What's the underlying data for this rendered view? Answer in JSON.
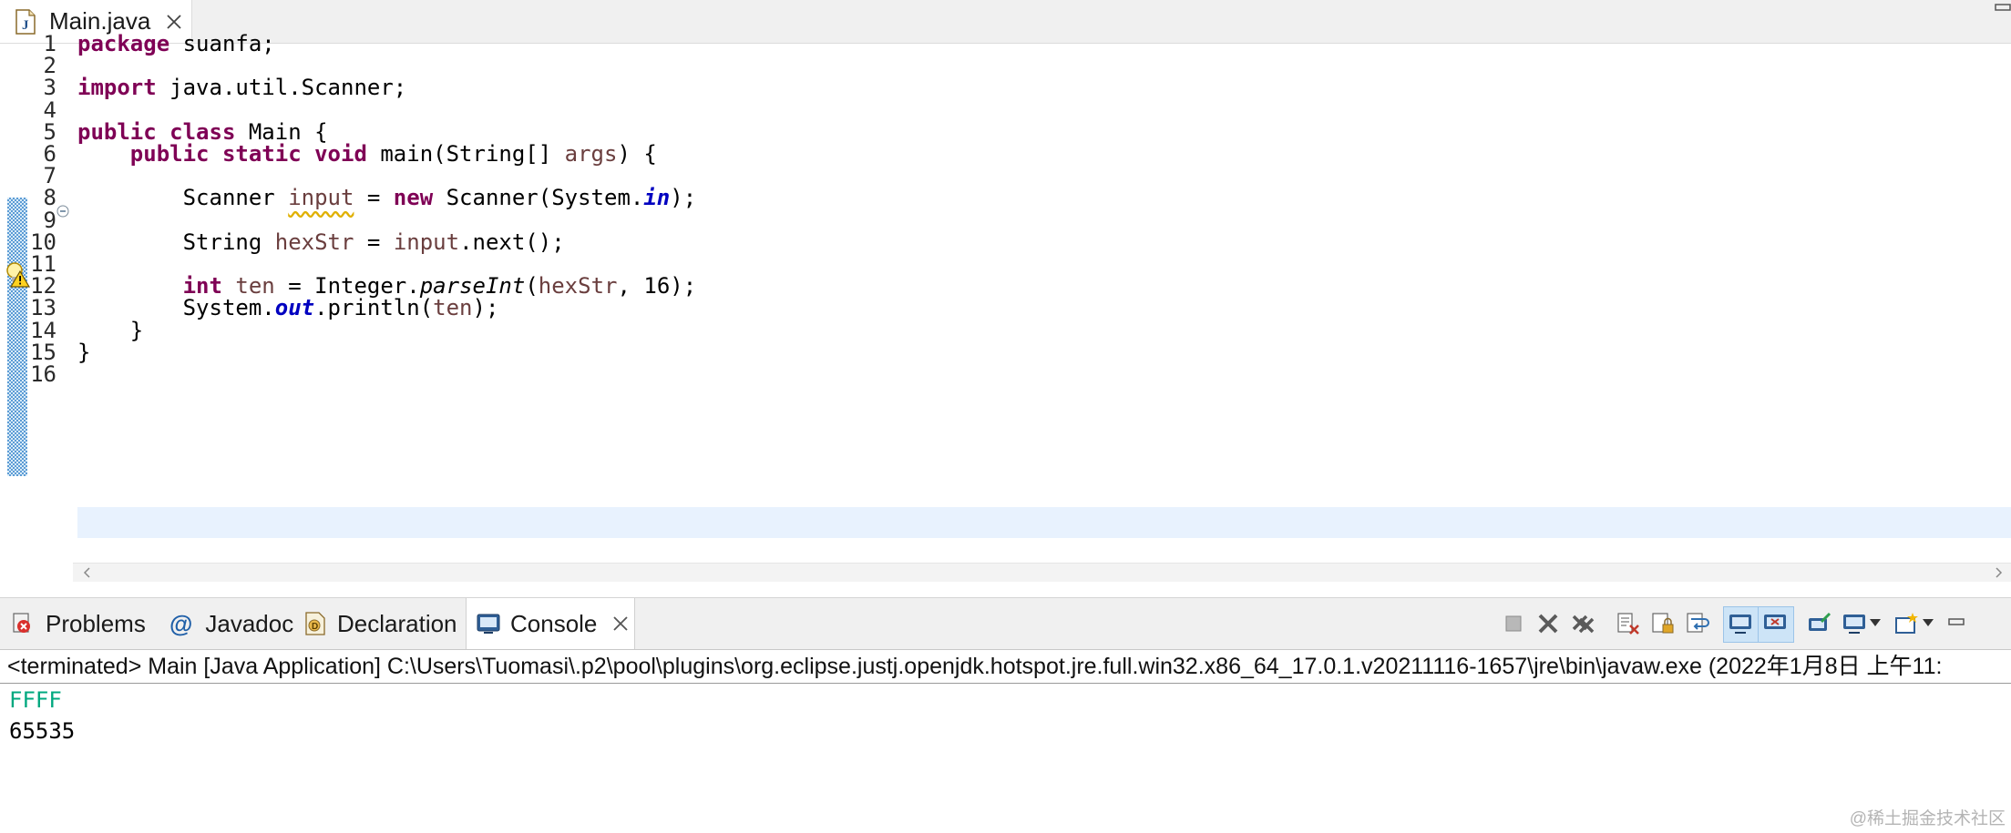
{
  "editor_tab": {
    "title": "Main.java"
  },
  "code": {
    "line_numbers": [
      "1",
      "2",
      "3",
      "4",
      "5",
      "6",
      "7",
      "8",
      "9",
      "10",
      "11",
      "12",
      "13",
      "14",
      "15",
      "16"
    ],
    "lines": [
      [
        {
          "t": "package",
          "k": "kw"
        },
        {
          "t": " suanfa;"
        }
      ],
      [],
      [
        {
          "t": "import",
          "k": "kw"
        },
        {
          "t": " java.util.Scanner;"
        }
      ],
      [],
      [
        {
          "t": "public",
          "k": "kw"
        },
        {
          "t": " "
        },
        {
          "t": "class",
          "k": "kw"
        },
        {
          "t": " Main {"
        }
      ],
      [
        {
          "t": "    "
        },
        {
          "t": "public",
          "k": "kw"
        },
        {
          "t": " "
        },
        {
          "t": "static",
          "k": "kw"
        },
        {
          "t": " "
        },
        {
          "t": "void",
          "k": "kw"
        },
        {
          "t": " main(String[] "
        },
        {
          "t": "args",
          "k": "var"
        },
        {
          "t": ") {"
        }
      ],
      [],
      [
        {
          "t": "        Scanner "
        },
        {
          "t": "input",
          "k": "var warnline"
        },
        {
          "t": " = "
        },
        {
          "t": "new",
          "k": "kw"
        },
        {
          "t": " Scanner(System."
        },
        {
          "t": "in",
          "k": "fld"
        },
        {
          "t": ");"
        }
      ],
      [],
      [
        {
          "t": "        String "
        },
        {
          "t": "hexStr",
          "k": "var"
        },
        {
          "t": " = "
        },
        {
          "t": "input",
          "k": "var"
        },
        {
          "t": ".next();"
        }
      ],
      [],
      [
        {
          "t": "        "
        },
        {
          "t": "int",
          "k": "kw"
        },
        {
          "t": " "
        },
        {
          "t": "ten",
          "k": "var"
        },
        {
          "t": " = Integer."
        },
        {
          "t": "parseInt",
          "k": "it"
        },
        {
          "t": "("
        },
        {
          "t": "hexStr",
          "k": "var"
        },
        {
          "t": ", 16);"
        }
      ],
      [
        {
          "t": "        System."
        },
        {
          "t": "out",
          "k": "fld"
        },
        {
          "t": ".println("
        },
        {
          "t": "ten",
          "k": "var"
        },
        {
          "t": ");"
        }
      ],
      [
        {
          "t": "    }"
        }
      ],
      [
        {
          "t": "}"
        }
      ],
      []
    ]
  },
  "views": {
    "tabs": [
      {
        "label": "Problems",
        "icon": "problems-icon"
      },
      {
        "label": "Javadoc",
        "icon": "javadoc-icon"
      },
      {
        "label": "Declaration",
        "icon": "declaration-icon"
      },
      {
        "label": "Console",
        "icon": "console-icon",
        "active": true
      }
    ]
  },
  "console": {
    "header": "<terminated> Main [Java Application] C:\\Users\\Tuomasi\\.p2\\pool\\plugins\\org.eclipse.justj.openjdk.hotspot.jre.full.win32.x86_64_17.0.1.v20211116-1657\\jre\\bin\\javaw.exe  (2022年1月8日 上午11:",
    "input_line": "FFFF",
    "output_line": "65535"
  },
  "watermark": "@稀土掘金技术社区",
  "colors": {
    "keyword": "#7f0055",
    "variable": "#6a3e3e",
    "field": "#0000c0",
    "console_input": "#00a87f",
    "current_line": "#e8f2fe"
  }
}
